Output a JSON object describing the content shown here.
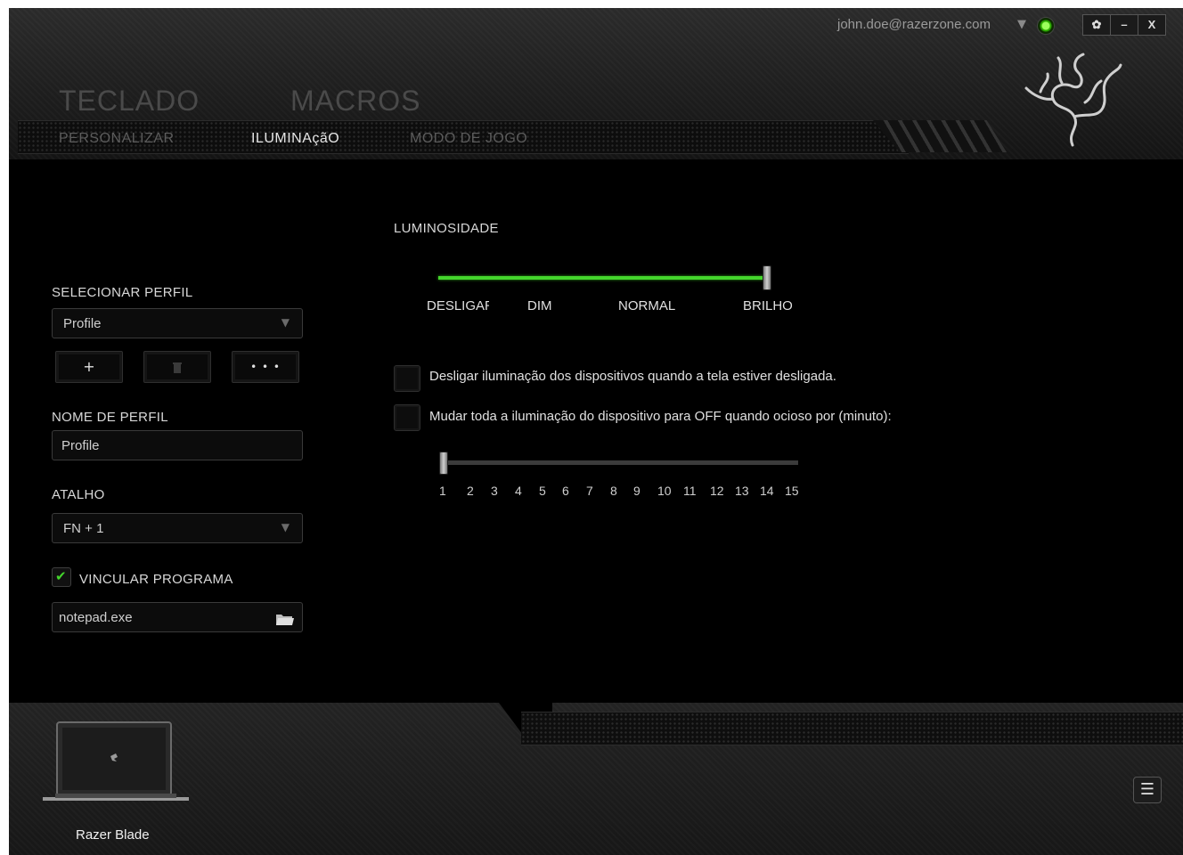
{
  "account": {
    "email": "john.doe@razerzone.com",
    "dropdown_icon": "▼",
    "status_icon": "online-status-icon"
  },
  "window_controls": {
    "settings": "✿",
    "minimize": "–",
    "close": "X"
  },
  "main_tabs": [
    {
      "label": "TECLADO"
    },
    {
      "label": "MACROS"
    }
  ],
  "sub_tabs": [
    {
      "label": "PERSONALIZAR",
      "active": false
    },
    {
      "label": "ILUMINAçãO",
      "active": true
    },
    {
      "label": "MODO DE JOGO",
      "active": false
    }
  ],
  "profile": {
    "select_label": "SELECIONAR PERFIL",
    "selected": "Profile",
    "add_button": "+",
    "delete_icon": "trash-icon",
    "more_button": "• • •",
    "name_label": "NOME DE PERFIL",
    "name_value": "Profile",
    "shortcut_label": "ATALHO",
    "shortcut_value": "FN + 1",
    "link_program_label": "VINCULAR PROGRAMA",
    "link_program_checked": true,
    "program_value": "notepad.exe"
  },
  "lighting": {
    "brightness_label": "LUMINOSIDADE",
    "brightness_levels": [
      "DESLIGAR",
      "DIM",
      "NORMAL",
      "BRILHO"
    ],
    "brightness_value": "BRILHO",
    "option_screen_off": "Desligar iluminação dos dispositivos quando a tela estiver desligada.",
    "option_screen_off_checked": false,
    "option_idle": "Mudar toda a iluminação do dispositivo para OFF quando ocioso por (minuto):",
    "option_idle_checked": false,
    "idle_ticks": [
      "1",
      "2",
      "3",
      "4",
      "5",
      "6",
      "7",
      "8",
      "9",
      "10",
      "11",
      "12",
      "13",
      "14",
      "15"
    ],
    "idle_value": 1
  },
  "footer": {
    "device_name": "Razer Blade",
    "menu_icon": "☰"
  },
  "colors": {
    "accent": "#44d62c",
    "background": "#000000",
    "text": "#e0e0e0"
  }
}
